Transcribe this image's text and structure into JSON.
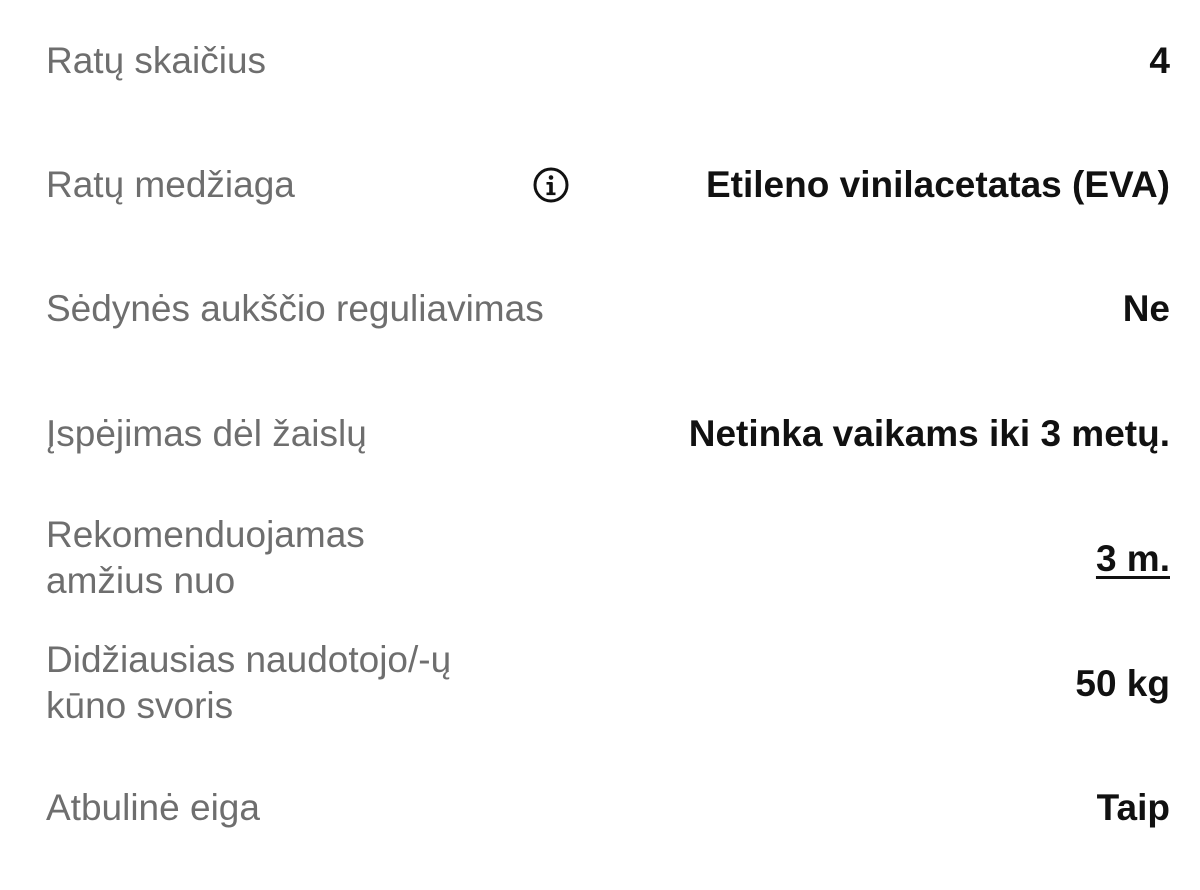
{
  "specs": [
    {
      "label": "Ratų skaičius",
      "value": "4"
    },
    {
      "label": "Ratų medžiaga",
      "value": "Etileno vinilacetatas (EVA)",
      "icon": "info-icon"
    },
    {
      "label": "Sėdynės aukščio reguliavimas",
      "value": "Ne"
    },
    {
      "label": "Įspėjimas dėl žaislų",
      "value": "Netinka vaikams iki 3 metų."
    },
    {
      "label": "Rekomenduojamas\namžius nuo",
      "value": "3 m."
    },
    {
      "label": "Didžiausias naudotojo/-ų\nkūno svoris",
      "value": "50 kg"
    },
    {
      "label": "Atbulinė eiga",
      "value": "Taip"
    }
  ]
}
